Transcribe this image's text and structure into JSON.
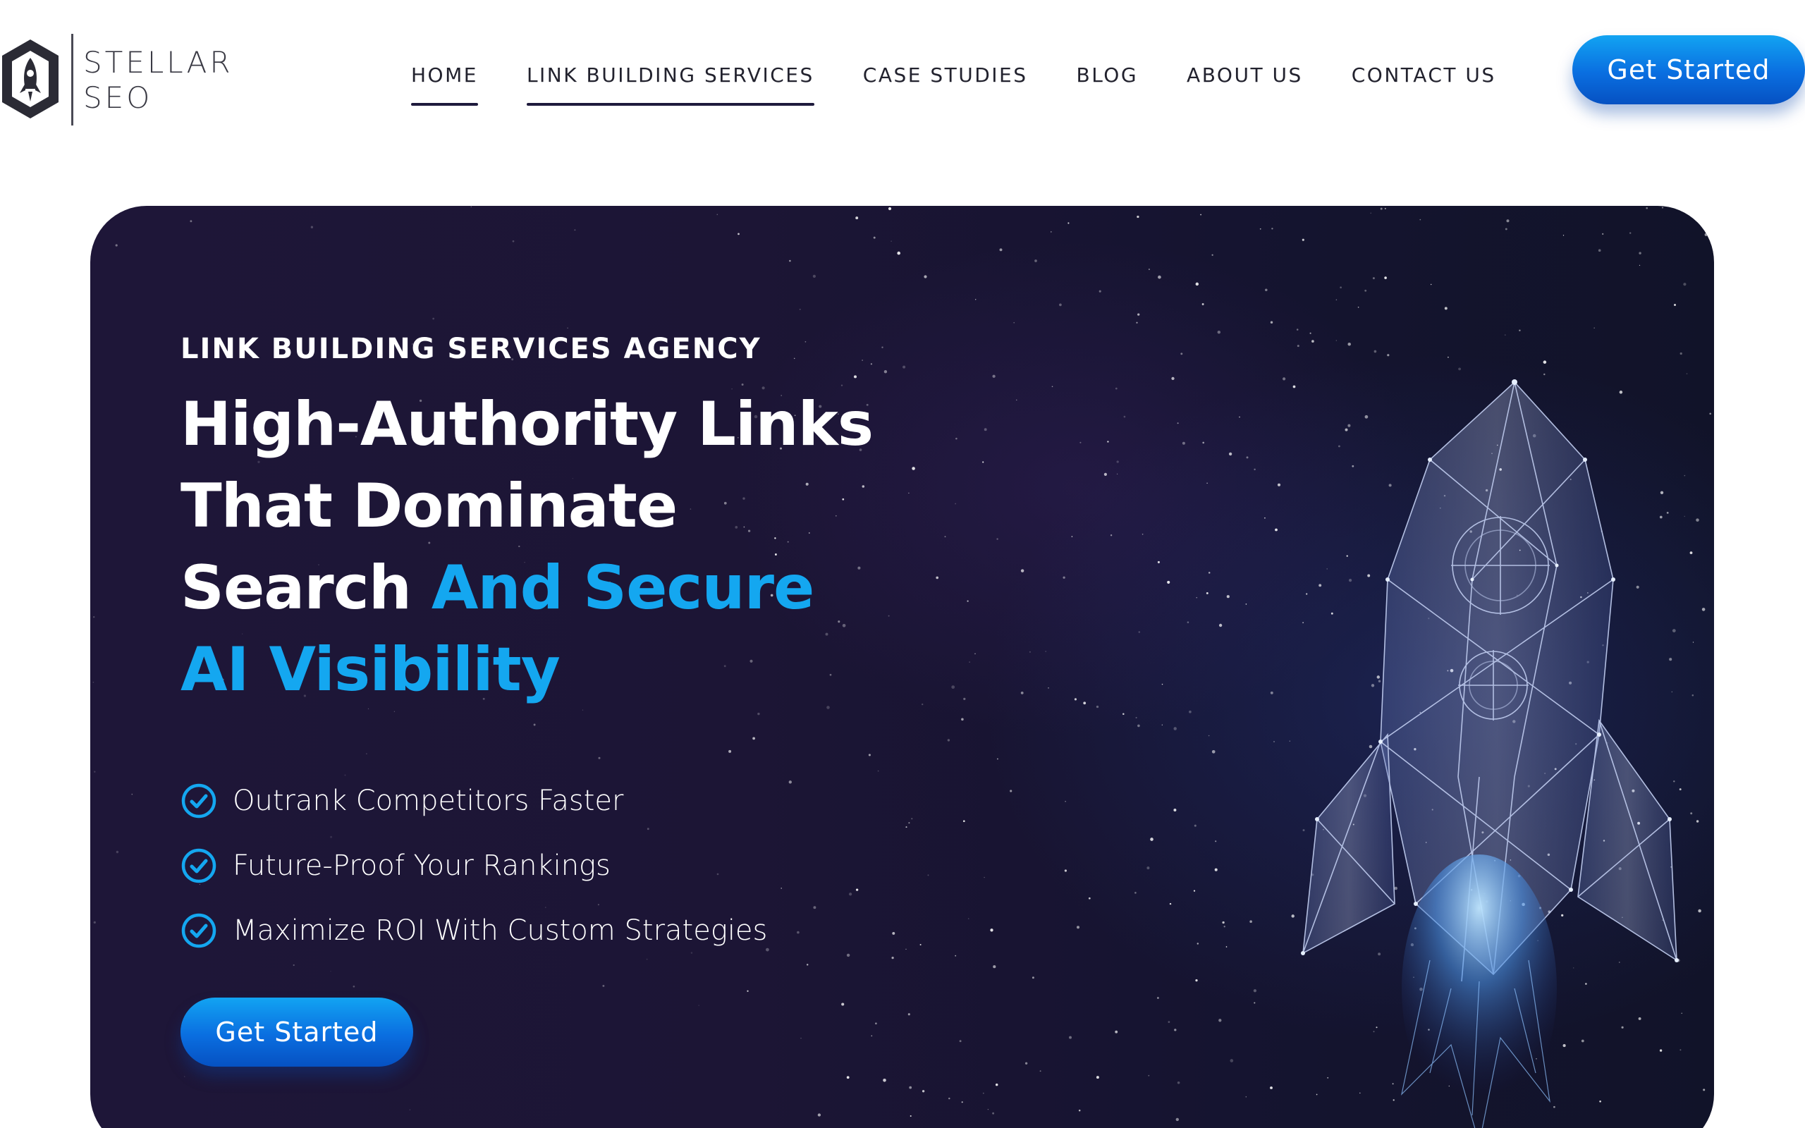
{
  "brand": {
    "line1": "STELLAR",
    "line2": "SEO",
    "logo_icon": "rocket-hexagon-icon"
  },
  "nav": {
    "items": [
      {
        "label": "HOME",
        "active": true
      },
      {
        "label": "LINK BUILDING SERVICES",
        "active": true
      },
      {
        "label": "CASE STUDIES",
        "active": false
      },
      {
        "label": "BLOG",
        "active": false
      },
      {
        "label": "ABOUT US",
        "active": false
      },
      {
        "label": "CONTACT US",
        "active": false
      }
    ]
  },
  "header": {
    "cta_label": "Get Started"
  },
  "hero": {
    "eyebrow": "LINK BUILDING SERVICES AGENCY",
    "headline_white_1": "High-Authority Links",
    "headline_white_2": "That Dominate",
    "headline_white_3": "Search ",
    "headline_accent_1": "And Secure",
    "headline_accent_2": "AI Visibility",
    "features": [
      "Outrank Competitors Faster",
      "Future-Proof Your Rankings",
      "Maximize ROI With Custom Strategies"
    ],
    "feature_icon": "check-circle-icon",
    "cta_label": "Get Started",
    "illustration": "wireframe-rocket-illustration"
  },
  "colors": {
    "accent": "#14a7f0",
    "button_gradient_top": "#12a4f2",
    "button_gradient_bottom": "#0651c2",
    "hero_background": "#1c1535",
    "nav_text": "#22222e",
    "nav_underline": "#1e1a3c"
  }
}
